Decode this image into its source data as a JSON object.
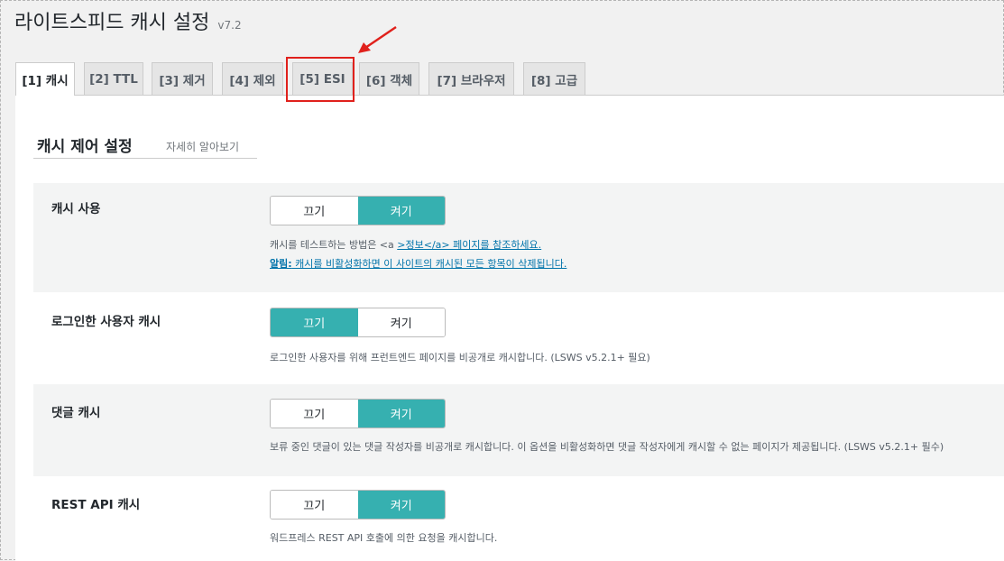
{
  "page": {
    "title": "라이트스피드 캐시 설정",
    "version": "v7.2"
  },
  "tabs": [
    {
      "label": "[1] 캐시",
      "active": true
    },
    {
      "label": "[2] TTL"
    },
    {
      "label": "[3] 제거"
    },
    {
      "label": "[4] 제외"
    },
    {
      "label": "[5] ESI"
    },
    {
      "label": "[6] 객체"
    },
    {
      "label": "[7] 브라우저"
    },
    {
      "label": "[8] 고급"
    }
  ],
  "section": {
    "title": "캐시 제어 설정",
    "learn_more": "자세히 알아보기"
  },
  "settings": [
    {
      "label": "캐시 사용",
      "off_label": "끄기",
      "on_label": "켜기",
      "value": "on",
      "desc_line1_text": "캐시를 테스트하는 방법은 <a ",
      "desc_line1_link": ">정보</a> 페이지를 참조하세요.",
      "desc_line2_strong": "알림:",
      "desc_line2_text": " 캐시를 비활성화하면 이 사이트의 캐시된 모든 항목이 삭제됩니다."
    },
    {
      "label": "로그인한 사용자 캐시",
      "off_label": "끄기",
      "on_label": "켜기",
      "value": "off",
      "desc": "로그인한 사용자를 위해 프런트엔드 페이지를 비공개로 캐시합니다. (LSWS v5.2.1+ 필요)"
    },
    {
      "label": "댓글 캐시",
      "off_label": "끄기",
      "on_label": "켜기",
      "value": "on",
      "desc": "보류 중인 댓글이 있는 댓글 작성자를 비공개로 캐시합니다. 이 옵션을 비활성화하면 댓글 작성자에게 캐시할 수 없는 페이지가 제공됩니다. (LSWS v5.2.1+ 필수)"
    },
    {
      "label": "REST API 캐시",
      "off_label": "끄기",
      "on_label": "켜기",
      "value": "on",
      "desc": "워드프레스 REST API 호출에 의한 요청을 캐시합니다."
    }
  ],
  "colors": {
    "accent": "#36b0b0",
    "highlight": "#e0211c",
    "link": "#0073aa"
  }
}
